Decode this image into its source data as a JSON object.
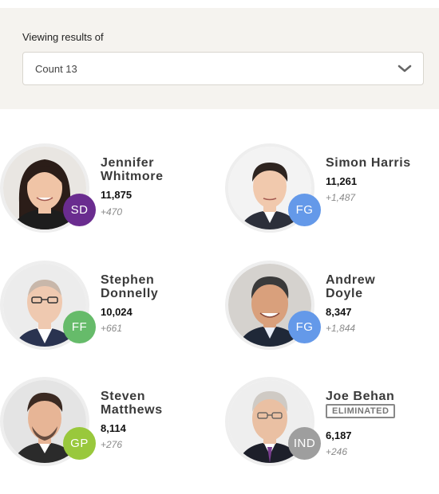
{
  "filter": {
    "label": "Viewing results of",
    "selected": "Count 13"
  },
  "candidates": [
    {
      "name_line1": "Jennifer",
      "name_line2": "Whitmore",
      "party": "SD",
      "party_color": "#6a2c8f",
      "votes": "11,875",
      "transfer": "+470",
      "status": "",
      "skin": "#f0c4a6",
      "hair": "#2b1d18",
      "shirt": "#1d1d1d"
    },
    {
      "name_line1": "Simon Harris",
      "name_line2": "",
      "party": "FG",
      "party_color": "#6499e9",
      "votes": "11,261",
      "transfer": "+1,487",
      "status": "",
      "skin": "#f1c9ad",
      "hair": "#2e2420",
      "shirt": "#2c2f3a"
    },
    {
      "name_line1": "Stephen",
      "name_line2": "Donnelly",
      "party": "FF",
      "party_color": "#66bb6a",
      "votes": "10,024",
      "transfer": "+661",
      "status": "",
      "skin": "#efc9b0",
      "hair": "#c8b7aa",
      "shirt": "#2a3350"
    },
    {
      "name_line1": "Andrew",
      "name_line2": "Doyle",
      "party": "FG",
      "party_color": "#6499e9",
      "votes": "8,347",
      "transfer": "+1,844",
      "status": "",
      "skin": "#d9a07c",
      "hair": "#3a3a3a",
      "shirt": "#1f2838"
    },
    {
      "name_line1": "Steven",
      "name_line2": "Matthews",
      "party": "GP",
      "party_color": "#99c83c",
      "votes": "8,114",
      "transfer": "+276",
      "status": "",
      "skin": "#e7b596",
      "hair": "#3b2a22",
      "shirt": "#2b2b2b"
    },
    {
      "name_line1": "Joe Behan",
      "name_line2": "",
      "party": "IND",
      "party_color": "#9e9e9e",
      "votes": "6,187",
      "transfer": "+246",
      "status": "ELIMINATED",
      "skin": "#eac0a3",
      "hair": "#cfcac4",
      "shirt": "#1d1f2a"
    }
  ]
}
